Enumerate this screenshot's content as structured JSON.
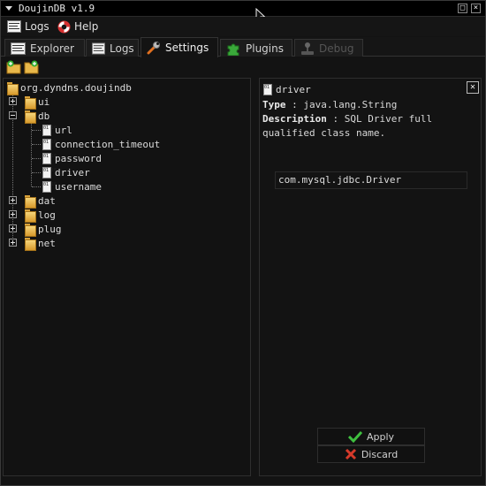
{
  "window": {
    "title": "DoujinDB v1.9"
  },
  "menu": [
    {
      "label": "Logs",
      "icon": "log-icon"
    },
    {
      "label": "Help",
      "icon": "lifebuoy-icon"
    }
  ],
  "tabs": [
    {
      "label": "Explorer",
      "icon": "explorer-icon",
      "state": "normal"
    },
    {
      "label": "Logs",
      "icon": "log-icon",
      "state": "normal"
    },
    {
      "label": "Settings",
      "icon": "wrench-icon",
      "state": "active"
    },
    {
      "label": "Plugins",
      "icon": "puzzle-icon",
      "state": "normal"
    },
    {
      "label": "Debug",
      "icon": "joystick-icon",
      "state": "disabled"
    }
  ],
  "toolbar": [
    {
      "icon": "folder-new-icon"
    },
    {
      "icon": "folder-add-icon"
    }
  ],
  "tree": {
    "root": "org.dyndns.doujindb",
    "nodes": [
      {
        "label": "ui",
        "type": "folder",
        "expanded": false
      },
      {
        "label": "db",
        "type": "folder",
        "expanded": true,
        "children": [
          "url",
          "connection_timeout",
          "password",
          "driver",
          "username"
        ]
      },
      {
        "label": "dat",
        "type": "folder",
        "expanded": false
      },
      {
        "label": "log",
        "type": "folder",
        "expanded": false
      },
      {
        "label": "plug",
        "type": "folder",
        "expanded": false
      },
      {
        "label": "net",
        "type": "folder",
        "expanded": false
      }
    ],
    "file_icon_text": "01 10"
  },
  "detail": {
    "name": "driver",
    "type_label": "Type",
    "type_value": "java.lang.String",
    "desc_label": "Description",
    "desc_line1": "SQL Driver full",
    "desc_line2": "qualified class name.",
    "value": "com.mysql.jdbc.Driver",
    "close_glyph": "✕"
  },
  "buttons": {
    "apply": "Apply",
    "discard": "Discard"
  },
  "colors": {
    "apply_check": "#3fbf3f",
    "discard_x": "#d63a2a",
    "folder": "#e8b84a"
  }
}
